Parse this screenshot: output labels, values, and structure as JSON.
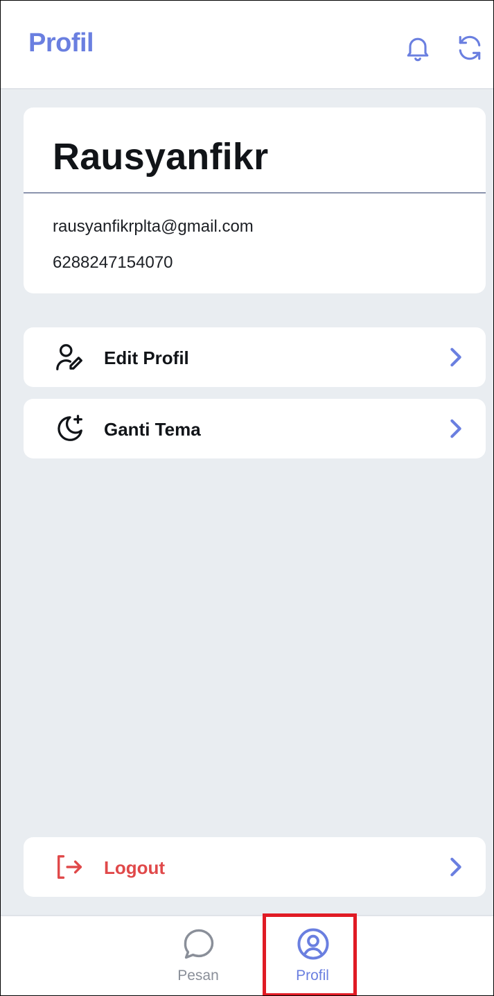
{
  "header": {
    "title": "Profil",
    "icons": [
      "bell-icon",
      "refresh-icon"
    ]
  },
  "profile": {
    "name": "Rausyanfikr",
    "email": "rausyanfikrplta@gmail.com",
    "phone": "6288247154070"
  },
  "menu": {
    "items": [
      {
        "label": "Edit Profil",
        "icon": "user-edit-icon"
      },
      {
        "label": "Ganti Tema",
        "icon": "moon-plus-icon"
      }
    ],
    "logout": {
      "label": "Logout",
      "icon": "logout-icon"
    }
  },
  "bottom_nav": {
    "items": [
      {
        "label": "Pesan",
        "icon": "chat-bubble-icon",
        "active": false
      },
      {
        "label": "Profil",
        "icon": "user-circle-icon",
        "active": true
      }
    ]
  },
  "colors": {
    "accent": "#6a7fe0",
    "danger": "#e0494a",
    "background": "#e9edf1",
    "highlight_box": "#e01b24"
  }
}
